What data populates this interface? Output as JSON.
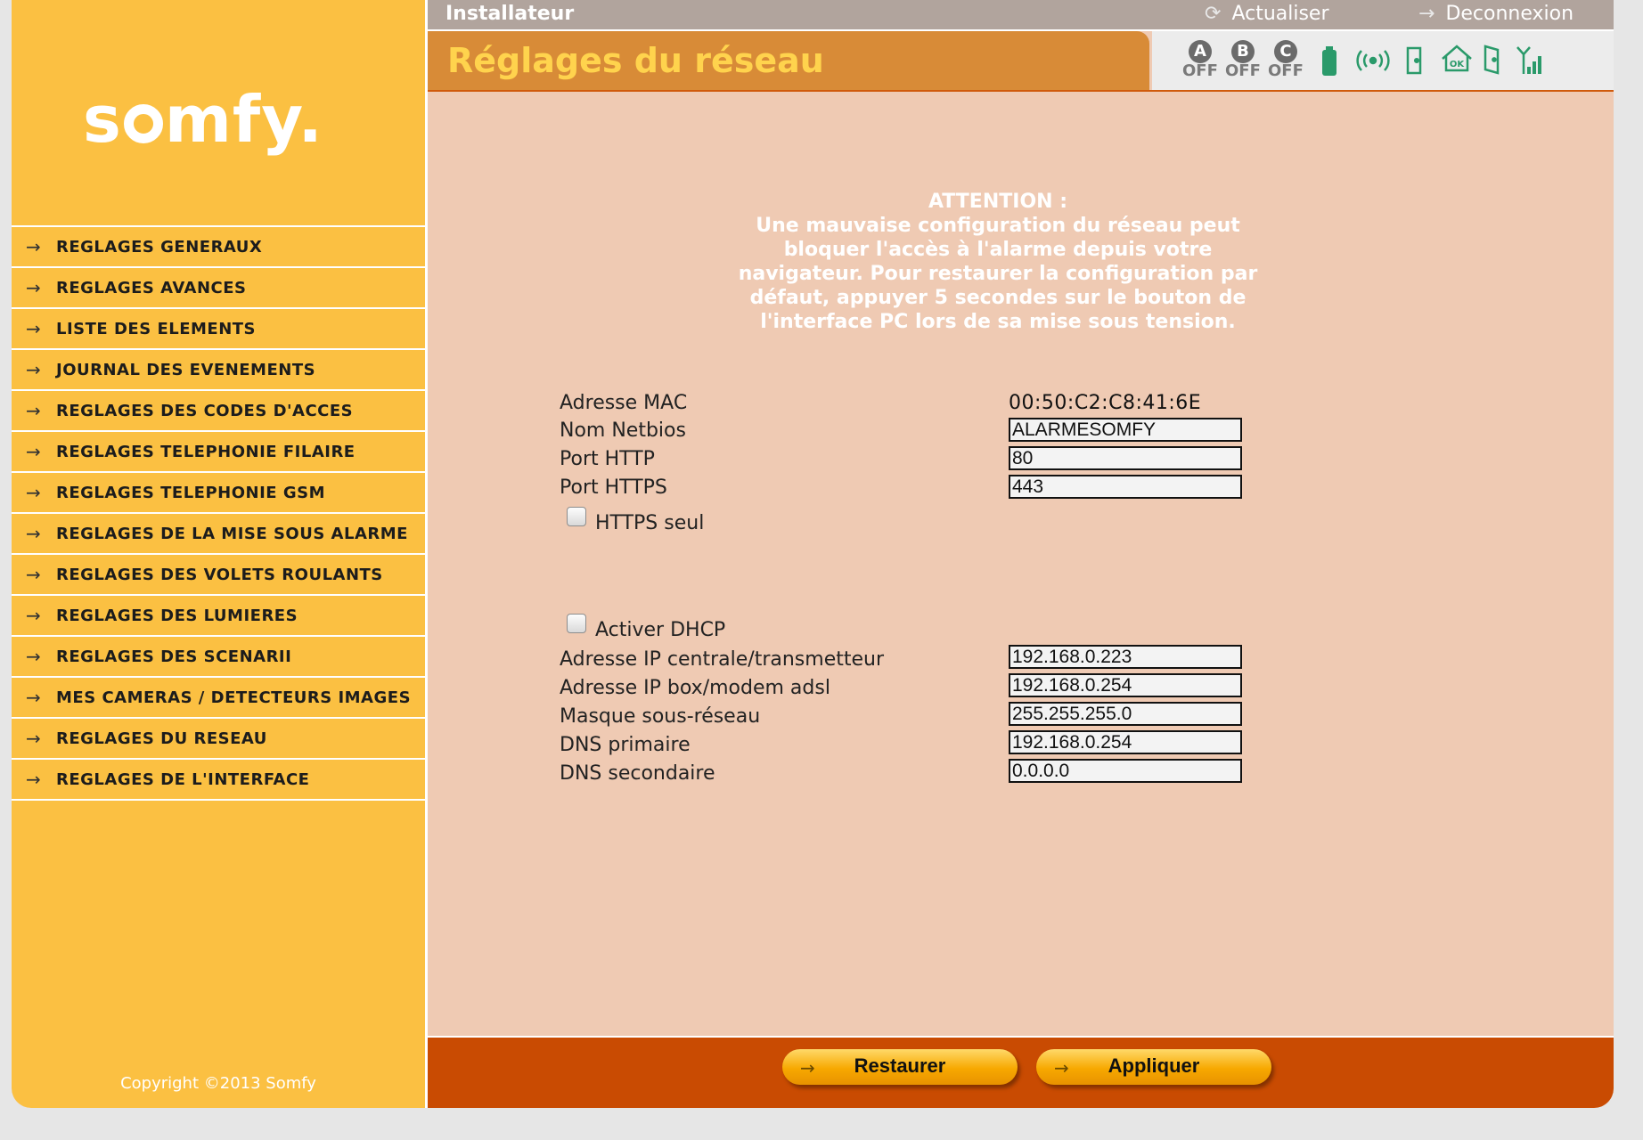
{
  "brand": {
    "logo_text": "somfy."
  },
  "topbar": {
    "role": "Installateur",
    "refresh_label": "Actualiser",
    "logout_label": "Deconnexion"
  },
  "page": {
    "title": "Réglages du réseau"
  },
  "status": {
    "zones": [
      {
        "letter": "A",
        "state": "OFF"
      },
      {
        "letter": "B",
        "state": "OFF"
      },
      {
        "letter": "C",
        "state": "OFF"
      }
    ],
    "icons": [
      "battery-icon",
      "radio-signal-icon",
      "door-sensor-icon",
      "house-ok-icon",
      "door-open-icon",
      "gsm-signal-icon"
    ],
    "icon_color": "#2a9a6a"
  },
  "sidebar": {
    "items": [
      {
        "label": "REGLAGES GENERAUX"
      },
      {
        "label": "REGLAGES AVANCES"
      },
      {
        "label": "LISTE DES ELEMENTS"
      },
      {
        "label": "JOURNAL DES EVENEMENTS"
      },
      {
        "label": "REGLAGES DES CODES D'ACCES"
      },
      {
        "label": "REGLAGES TELEPHONIE FILAIRE"
      },
      {
        "label": "REGLAGES TELEPHONIE GSM"
      },
      {
        "label": "REGLAGES DE LA MISE SOUS ALARME"
      },
      {
        "label": "REGLAGES DES VOLETS ROULANTS"
      },
      {
        "label": "REGLAGES DES LUMIERES"
      },
      {
        "label": "REGLAGES DES SCENARII"
      },
      {
        "label": "MES CAMERAS / DETECTEURS IMAGES"
      },
      {
        "label": "REGLAGES DU RESEAU"
      },
      {
        "label": "REGLAGES DE L'INTERFACE"
      }
    ],
    "copyright": "Copyright ©2013 Somfy"
  },
  "warning": {
    "title": "ATTENTION :",
    "text": "Une mauvaise configuration du réseau peut bloquer l'accès à l'alarme depuis votre navigateur. Pour restaurer la configuration par défaut, appuyer 5 secondes sur le bouton de l'interface PC lors de sa mise sous tension."
  },
  "form": {
    "mac_label": "Adresse MAC",
    "mac_value": "00:50:C2:C8:41:6E",
    "netbios_label": "Nom Netbios",
    "netbios_value": "ALARMESOMFY",
    "http_label": "Port HTTP",
    "http_value": "80",
    "https_label": "Port HTTPS",
    "https_value": "443",
    "https_only_label": "HTTPS seul",
    "dhcp_label": "Activer DHCP",
    "ip_central_label": "Adresse IP centrale/transmetteur",
    "ip_central_value": "192.168.0.223",
    "ip_box_label": "Adresse IP box/modem adsl",
    "ip_box_value": "192.168.0.254",
    "mask_label": "Masque sous-réseau",
    "mask_value": "255.255.255.0",
    "dns1_label": "DNS primaire",
    "dns1_value": "192.168.0.254",
    "dns2_label": "DNS secondaire",
    "dns2_value": "0.0.0.0"
  },
  "footer": {
    "restore_label": "Restaurer",
    "apply_label": "Appliquer"
  }
}
